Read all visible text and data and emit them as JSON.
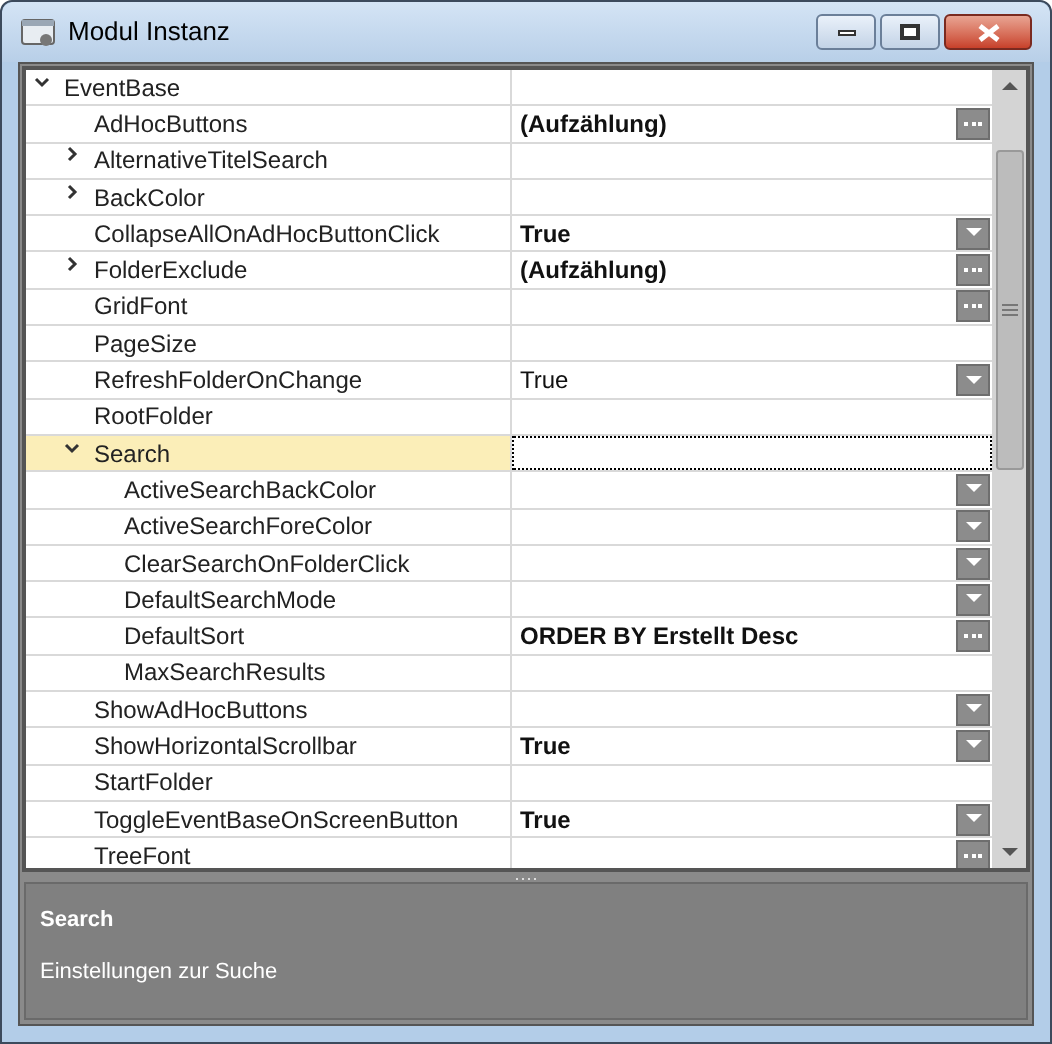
{
  "window": {
    "title": "Modul Instanz"
  },
  "properties": [
    {
      "name": "EventBase",
      "expanded": true,
      "selected": false,
      "children": [
        {
          "name": "AdHocButtons",
          "value": "(Aufzählung)",
          "modified": true,
          "kind": "ellipsis",
          "selected": false
        },
        {
          "name": "AlternativeTitelSearch",
          "expanded": false,
          "selected": false
        },
        {
          "name": "BackColor",
          "expanded": false,
          "selected": false
        },
        {
          "name": "CollapseAllOnAdHocButtonClick",
          "value": "True",
          "modified": true,
          "kind": "dropdown",
          "selected": false
        },
        {
          "name": "FolderExclude",
          "value": "(Aufzählung)",
          "modified": true,
          "expanded": false,
          "kind": "ellipsis",
          "selected": false
        },
        {
          "name": "GridFont",
          "kind": "ellipsis",
          "selected": false
        },
        {
          "name": "PageSize",
          "selected": false
        },
        {
          "name": "RefreshFolderOnChange",
          "value": "True",
          "modified": false,
          "kind": "dropdown",
          "selected": false
        },
        {
          "name": "RootFolder",
          "selected": false
        },
        {
          "name": "Search",
          "expanded": true,
          "selected": true,
          "children": [
            {
              "name": "ActiveSearchBackColor",
              "kind": "dropdown",
              "selected": false
            },
            {
              "name": "ActiveSearchForeColor",
              "kind": "dropdown",
              "selected": false
            },
            {
              "name": "ClearSearchOnFolderClick",
              "kind": "dropdown",
              "selected": false
            },
            {
              "name": "DefaultSearchMode",
              "kind": "dropdown",
              "selected": false
            },
            {
              "name": "DefaultSort",
              "value": "ORDER BY Erstellt Desc",
              "modified": true,
              "kind": "ellipsis",
              "selected": false
            },
            {
              "name": "MaxSearchResults",
              "selected": false
            }
          ]
        },
        {
          "name": "ShowAdHocButtons",
          "kind": "dropdown",
          "selected": false
        },
        {
          "name": "ShowHorizontalScrollbar",
          "value": "True",
          "modified": true,
          "kind": "dropdown",
          "selected": false
        },
        {
          "name": "StartFolder",
          "selected": false
        },
        {
          "name": "ToggleEventBaseOnScreenButton",
          "value": "True",
          "modified": true,
          "kind": "dropdown",
          "selected": false
        },
        {
          "name": "TreeFont",
          "kind": "ellipsis",
          "selected": false
        }
      ]
    }
  ],
  "description": {
    "title": "Search",
    "text": "Einstellungen zur Suche"
  }
}
